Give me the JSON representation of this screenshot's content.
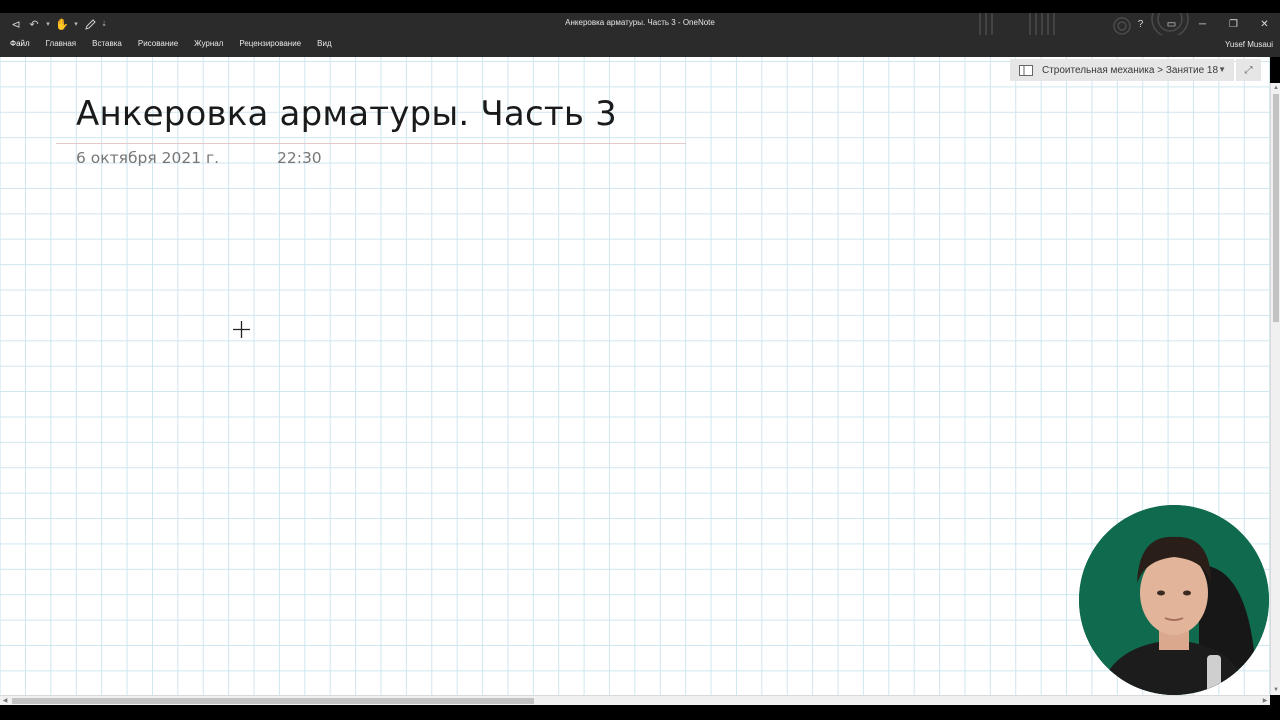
{
  "window": {
    "title": "Анкеровка арматуры. Часть 3 - OneNote",
    "user": "Yusef Musaui",
    "controls": {
      "help": "?",
      "ribbon_display": "▭",
      "minimize": "─",
      "restore": "❐",
      "close": "✕"
    }
  },
  "quick_access": {
    "back": "⊲",
    "undo": "↶",
    "undo_caret": "▾",
    "touch": "✋",
    "touch_caret": "▾",
    "customize": "⇣"
  },
  "ribbon": {
    "tabs": [
      {
        "label": "Файл"
      },
      {
        "label": "Главная"
      },
      {
        "label": "Вставка"
      },
      {
        "label": "Рисование"
      },
      {
        "label": "Журнал"
      },
      {
        "label": "Рецензирование"
      },
      {
        "label": "Вид"
      }
    ]
  },
  "navigation": {
    "breadcrumb": "Строительная механика > Занятие 18",
    "caret": "▼",
    "expand": "⤢"
  },
  "page": {
    "title": "Анкеровка арматуры. Часть 3",
    "date": "6 октября 2021 г.",
    "time": "22:30"
  },
  "scrollbars": {
    "up": "▲",
    "down": "▼",
    "left": "◀",
    "right": "▶",
    "vertical_position": 0.0,
    "horizontal_position": 0.0
  },
  "colors": {
    "chrome": "#2b2b2b",
    "grid_line": "#cfe6ef",
    "webcam_bg": "#0f6a4e"
  }
}
